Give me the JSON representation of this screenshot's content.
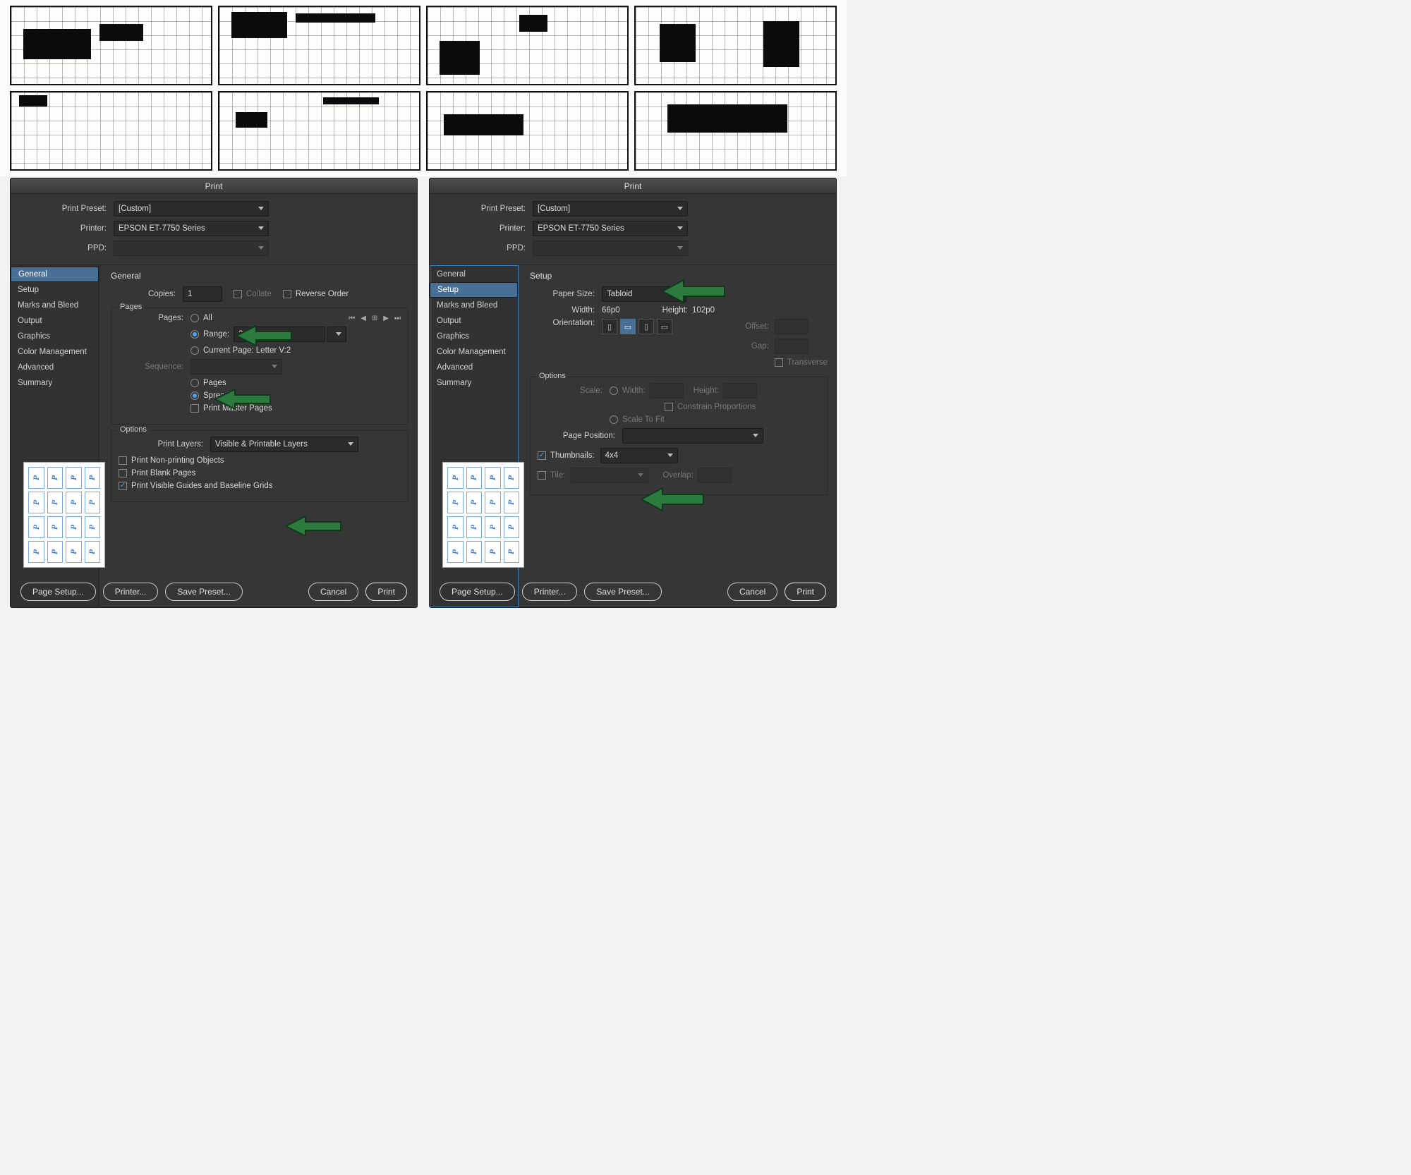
{
  "dialog_title": "Print",
  "top_fields": {
    "preset_label": "Print Preset:",
    "preset_value": "[Custom]",
    "printer_label": "Printer:",
    "printer_value": "EPSON ET-7750 Series",
    "ppd_label": "PPD:",
    "ppd_value": ""
  },
  "sidebar_items": [
    "General",
    "Setup",
    "Marks and Bleed",
    "Output",
    "Graphics",
    "Color Management",
    "Advanced",
    "Summary"
  ],
  "general": {
    "heading": "General",
    "copies_label": "Copies:",
    "copies_value": "1",
    "collate_label": "Collate",
    "reverse_label": "Reverse Order",
    "pages_group": "Pages",
    "pages_label": "Pages:",
    "all_label": "All",
    "range_label": "Range:",
    "range_value": "2-35",
    "current_label": "Current Page: Letter V:2",
    "sequence_label": "Sequence:",
    "sequence_value": "",
    "pages_radio": "Pages",
    "spreads_radio": "Spreads",
    "master_label": "Print Master Pages",
    "options_group": "Options",
    "layers_label": "Print Layers:",
    "layers_value": "Visible & Printable Layers",
    "nonprint_label": "Print Non-printing Objects",
    "blank_label": "Print Blank Pages",
    "guides_label": "Print Visible Guides and Baseline Grids"
  },
  "setup": {
    "heading": "Setup",
    "paper_label": "Paper Size:",
    "paper_value": "Tabloid",
    "width_label": "Width:",
    "width_value": "66p0",
    "height_label": "Height:",
    "height_value": "102p0",
    "orientation_label": "Orientation:",
    "offset_label": "Offset:",
    "gap_label": "Gap:",
    "transverse_label": "Transverse",
    "options_group": "Options",
    "scale_label": "Scale:",
    "scale_width_label": "Width:",
    "scale_height_label": "Height:",
    "constrain_label": "Constrain Proportions",
    "scalefit_label": "Scale To Fit",
    "pagepos_label": "Page Position:",
    "pagepos_value": "",
    "thumbs_label": "Thumbnails:",
    "thumbs_value": "4x4",
    "tile_label": "Tile:",
    "overlap_label": "Overlap:"
  },
  "footer": {
    "page_setup": "Page Setup...",
    "printer": "Printer...",
    "save_preset": "Save Preset...",
    "cancel": "Cancel",
    "print": "Print"
  },
  "arrow_color": "#2d7a3e"
}
